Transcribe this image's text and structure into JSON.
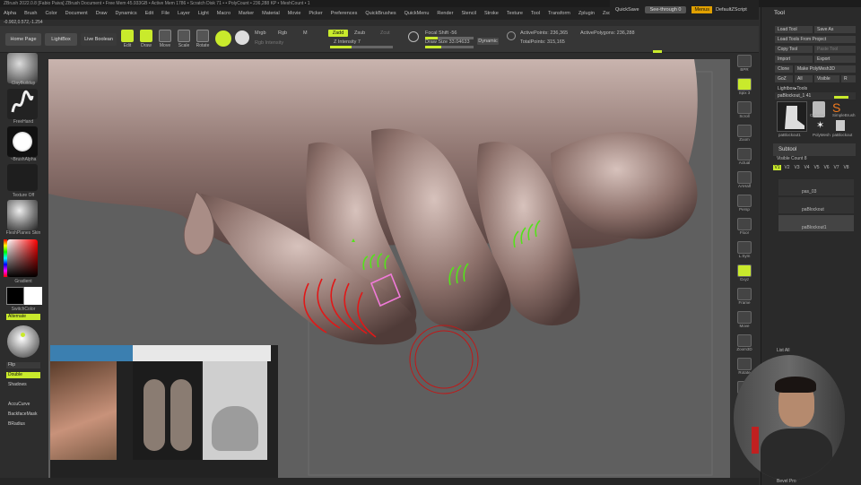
{
  "window": {
    "title": "ZBrush 2022.0.8 [Fabio Paiva]   ZBrush Document      • Free Mem 45.933GB • Active Mem 1786 • Scratch Disk 71 •  • PolyCount • 236,288 KP • MeshCount • 1"
  },
  "menu": [
    "Alpha",
    "Brush",
    "Color",
    "Document",
    "Draw",
    "Dynamics",
    "Edit",
    "File",
    "Layer",
    "Light",
    "Macro",
    "Marker",
    "Material",
    "Movie",
    "Picker",
    "Preferences",
    "QuickBrushes",
    "QuickMenu",
    "Render",
    "Stencil",
    "Stroke",
    "Texture",
    "Tool",
    "Transform",
    "Zplugin",
    "Zscript",
    "Help"
  ],
  "topright": {
    "quicksave": "QuickSave",
    "seethrough": "See-through  0",
    "menus": "Menus",
    "defaultzscript": "DefaultZScript"
  },
  "coords": "-0.902,0.572,-1.254",
  "toolbar": {
    "home_page": "Home Page",
    "lightbox": "LightBox",
    "live_boolean": "Live Boolean",
    "edit": "Edit",
    "draw": "Draw",
    "move": "Move",
    "scale": "Scale",
    "rotate": "Rotate",
    "mrgb": "Mrgb",
    "rgb": "Rgb",
    "m": "M",
    "zadd": "Zadd",
    "zsub": "Zsub",
    "zcut": "Zcut",
    "rgb_intensity": "Rgb Intensity",
    "z_intensity": "Z Intensity  7",
    "focal_shift": "Focal Shift  -56",
    "draw_size": "Draw Size  33.04633",
    "dynamic": "Dynamic",
    "active_points": "ActivePoints: 236,365",
    "total_points": "TotalPoints: 315,165",
    "active_polygons": "ActivePolygons: 236,288",
    "z_intensity_value": 7,
    "draw_size_value": 33.04633,
    "focal_shift_value": -56
  },
  "leftshelf": {
    "brush": "ClayBuildup",
    "stroke": "FreeHand",
    "alpha": "~BrushAlpha",
    "texture": "Texture Off",
    "material": "FleshPlanes Skin",
    "gradient": "Gradient",
    "switchcolor": "SwitchColor",
    "alternate": "Alternate",
    "flip": "Flip",
    "double": "Double",
    "shadows": "Shadows",
    "accucurve": "AccuCurve",
    "backfacemask": "BackfaceMask",
    "bradius": "BRadius"
  },
  "rightshelf": [
    "BPR",
    "Spix 3",
    "Scroll",
    "Zoom",
    "Actual",
    "AAHalf",
    "Persp",
    "Floor",
    "L.Sym",
    "Gxyz",
    "Frame",
    "Move",
    "Zoom3D",
    "Rotate",
    "Line Fill PolyF",
    "Transp"
  ],
  "toolpalette": {
    "header": "Tool",
    "load_tool": "Load Tool",
    "save_as": "Save As",
    "load_from_project": "Load Tools From Project",
    "copy_tool": "Copy Tool",
    "paste_tool": "Paste Tool",
    "import": "Import",
    "export": "Export",
    "clone": "Clone",
    "make_polymesh": "Make PolyMesh3D",
    "goz": "GoZ",
    "all": "All",
    "visible": "Visible",
    "r": "R",
    "lightbox_tools": "Lightbox▸Tools",
    "current_tool": "paBlockout_1  41",
    "thumb1": "paBlockout1",
    "thumb2": "Cylinder",
    "thumb3": "SimpleBrush",
    "thumb4": "PolyMesh",
    "thumb5": "paBlockout",
    "subtool": "Subtool",
    "visible_count": "Visible Count  8",
    "v_buttons": [
      "V1",
      "V2",
      "V3",
      "V4",
      "V5",
      "V6",
      "V7",
      "V8"
    ],
    "subtool_items": [
      "pas_03",
      "paBlockout",
      "paBlockout1"
    ],
    "list_all": "List All",
    "bevel_pro": "Bevel Pro"
  },
  "colors": {
    "accent": "#c9ea2c",
    "menus_btn": "#e0a000",
    "red_curve": "#e01818",
    "green_curve": "#55e11c",
    "pink_curve": "#f07ad8"
  }
}
